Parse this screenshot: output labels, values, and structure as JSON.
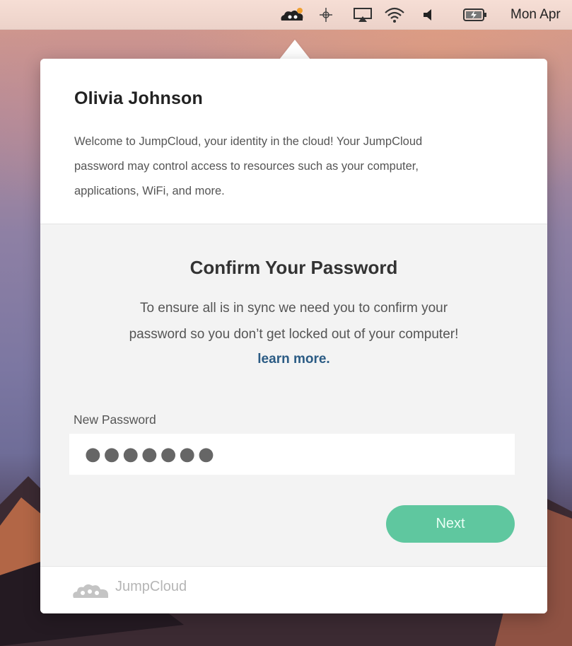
{
  "menubar": {
    "icons": [
      "jumpcloud-icon",
      "crosshair-icon",
      "airplay-icon",
      "wifi-icon",
      "volume-icon",
      "battery-icon"
    ],
    "clock": "Mon Apr"
  },
  "welcome": {
    "name": "Olivia Johnson",
    "line1": "Welcome to JumpCloud, your identity in the cloud! Your JumpCloud",
    "line2": "password may control access to resources such as your computer,",
    "line3": "applications, WiFi, and more."
  },
  "confirm": {
    "title": "Confirm Your Password",
    "line1": "To ensure all is in sync we need you to confirm your",
    "line2": "password so you don’t get locked out of your computer!",
    "learn_more": "learn more.",
    "field_label": "New Password",
    "password_value": "●●●●●●●",
    "next_label": "Next"
  },
  "footer": {
    "brand": "JumpCloud"
  },
  "colors": {
    "accent_green": "#5fc79f",
    "link_blue": "#2b5b84"
  }
}
